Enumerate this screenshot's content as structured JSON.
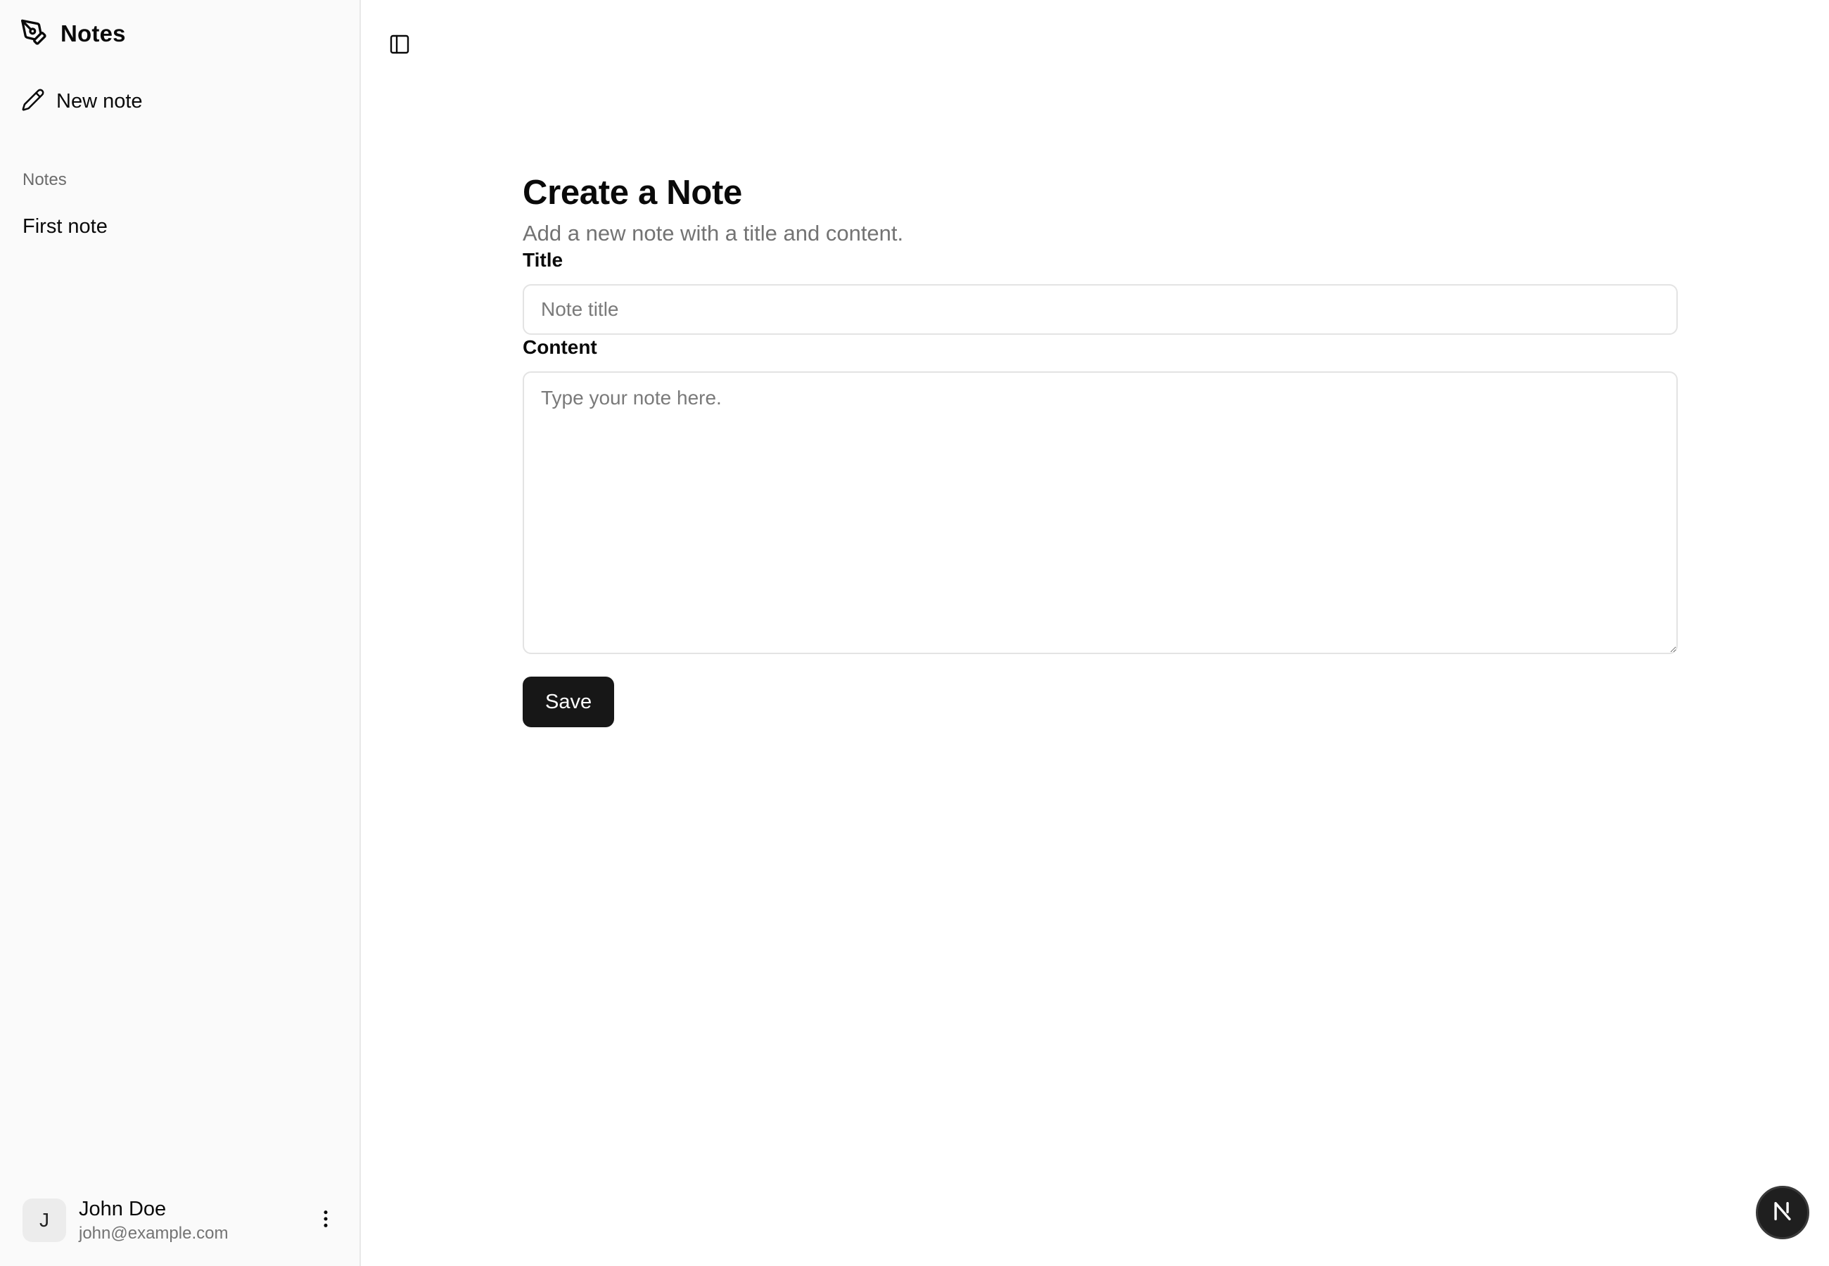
{
  "sidebar": {
    "brand_title": "Notes",
    "new_note_label": "New note",
    "group_label": "Notes",
    "notes": [
      {
        "title": "First note"
      }
    ],
    "user": {
      "avatar_initial": "J",
      "name": "John Doe",
      "email": "john@example.com"
    }
  },
  "main": {
    "title": "Create a Note",
    "subtitle": "Add a new note with a title and content.",
    "title_field": {
      "label": "Title",
      "placeholder": "Note title",
      "value": ""
    },
    "content_field": {
      "label": "Content",
      "placeholder": "Type your note here.",
      "value": ""
    },
    "save_label": "Save"
  },
  "icons": {
    "brand": "pen-tool-icon",
    "new_note": "pencil-icon",
    "user_menu": "more-vertical-icon",
    "sidebar_toggle": "panel-left-icon",
    "dev_badge": "nextjs-n-icon"
  },
  "colors": {
    "sidebar_bg": "#fafafa",
    "primary_button": "#171717",
    "muted_text": "#737373",
    "border": "#e3e3e3"
  }
}
